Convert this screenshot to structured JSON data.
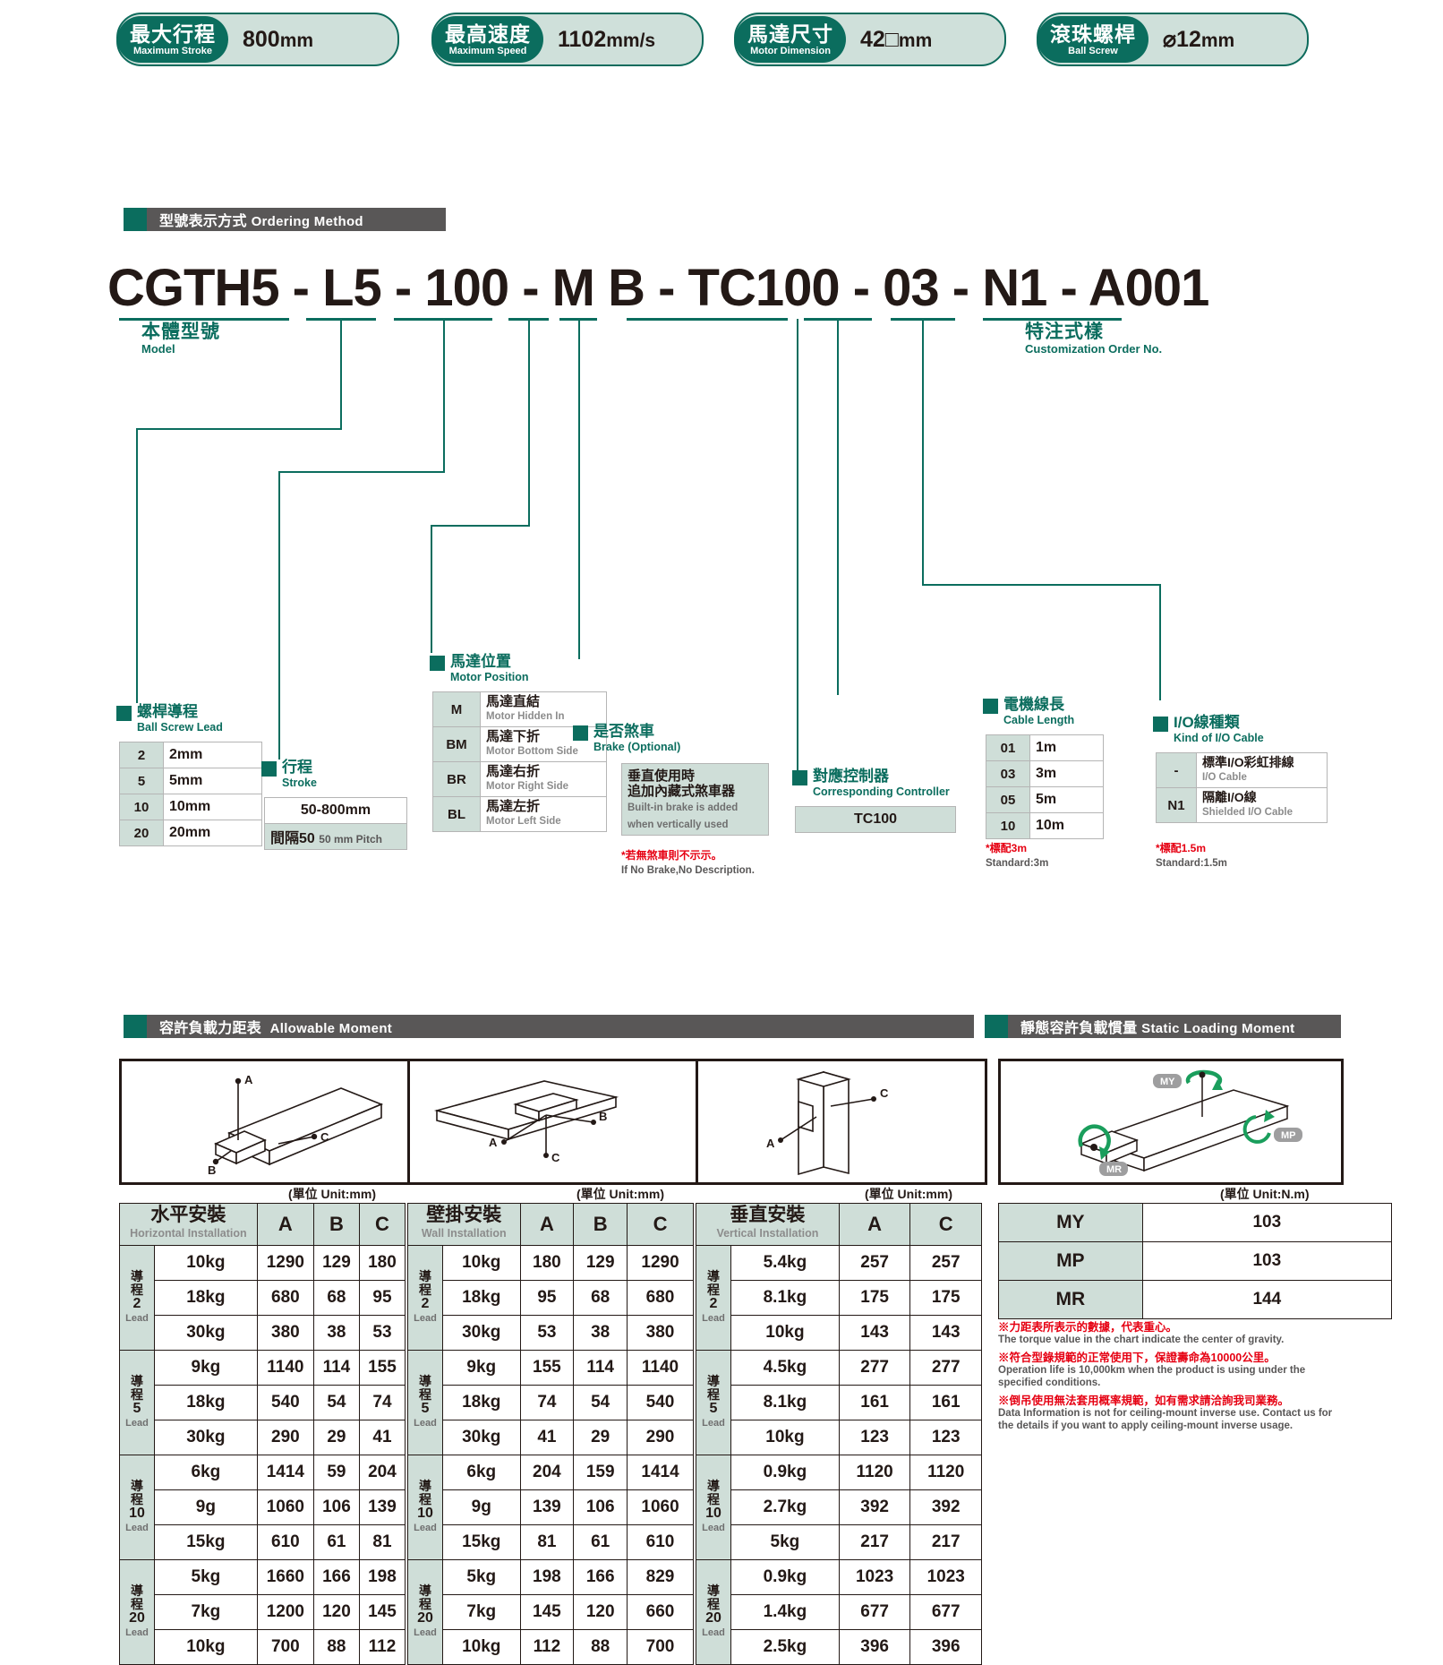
{
  "header_badges": [
    {
      "cn": "最大行程",
      "en": "Maximum Stroke",
      "value": "800",
      "unit": "mm"
    },
    {
      "cn": "最高速度",
      "en": "Maximum Speed",
      "value": "1102",
      "unit": "mm/s"
    },
    {
      "cn": "馬達尺寸",
      "en": "Motor Dimension",
      "value": "42□",
      "unit": "mm"
    },
    {
      "cn": "滾珠螺桿",
      "en": "Ball Screw",
      "value": "⌀12",
      "unit": "mm"
    }
  ],
  "sections": {
    "ordering": {
      "cn": "型號表示方式",
      "en": "Ordering Method"
    },
    "allowable": {
      "cn": "容許負載力距表",
      "en": "Allowable Moment"
    },
    "static": {
      "cn": "靜態容許負載慣量",
      "en": "Static Loading Moment"
    }
  },
  "ordering": {
    "code": "CGTH5 - L5 - 100 - M B - TC100 - 03 - N1 - A001",
    "model_label": {
      "cn": "本體型號",
      "en": "Model"
    },
    "custom_label": {
      "cn": "特注式樣",
      "en": "Customization Order No."
    },
    "ball_screw_lead": {
      "cn": "螺桿導程",
      "en": "Ball Screw Lead",
      "rows": [
        [
          "2",
          "2mm"
        ],
        [
          "5",
          "5mm"
        ],
        [
          "10",
          "10mm"
        ],
        [
          "20",
          "20mm"
        ]
      ]
    },
    "stroke": {
      "cn": "行程",
      "en": "Stroke",
      "value": "50-800mm",
      "pitch_cn": "間隔50",
      "pitch_en": "50 mm Pitch"
    },
    "motor_position": {
      "cn": "馬達位置",
      "en": "Motor Position",
      "rows": [
        [
          "M",
          "馬達直結",
          "Motor Hidden In"
        ],
        [
          "BM",
          "馬達下折",
          "Motor Bottom Side"
        ],
        [
          "BR",
          "馬達右折",
          "Motor Right Side"
        ],
        [
          "BL",
          "馬達左折",
          "Motor Left Side"
        ]
      ]
    },
    "brake": {
      "cn": "是否煞車",
      "en": "Brake (Optional)",
      "desc_cn": "垂直使用時\n追加內藏式煞車器",
      "desc_cn1": "垂直使用時",
      "desc_cn2": "追加內藏式煞車器",
      "desc_en1": "Built-in brake is added",
      "desc_en2": "when vertically used",
      "note_red": "*若無煞車則不示示。",
      "note_gray": "If No Brake,No Description."
    },
    "controller": {
      "cn": "對應控制器",
      "en": "Corresponding Controller",
      "value": "TC100"
    },
    "cable_length": {
      "cn": "電機線長",
      "en": "Cable Length",
      "rows": [
        [
          "01",
          "1m"
        ],
        [
          "03",
          "3m"
        ],
        [
          "05",
          "5m"
        ],
        [
          "10",
          "10m"
        ]
      ],
      "note_red": "*標配3m",
      "note_gray": "Standard:3m"
    },
    "io_cable": {
      "cn": "I/O線種類",
      "en": "Kind of I/O Cable",
      "rows": [
        [
          "-",
          "標準I/O彩虹排線",
          "I/O Cable"
        ],
        [
          "N1",
          "隔離I/O線",
          "Shielded I/O Cable"
        ]
      ],
      "note_red": "*標配1.5m",
      "note_gray": "Standard:1.5m"
    }
  },
  "moment_tables": {
    "unit_label": "(單位 Unit:mm)",
    "horizontal": {
      "cn": "水平安裝",
      "en": "Horizontal Installation",
      "columns": [
        "A",
        "B",
        "C"
      ],
      "groups": [
        {
          "lead": "2",
          "lead_cn": "導程",
          "lead_en": "Lead",
          "rows": [
            {
              "kg": "10kg",
              "vals": [
                "1290",
                "129",
                "180"
              ]
            },
            {
              "kg": "18kg",
              "vals": [
                "680",
                "68",
                "95"
              ]
            },
            {
              "kg": "30kg",
              "vals": [
                "380",
                "38",
                "53"
              ]
            }
          ]
        },
        {
          "lead": "5",
          "lead_cn": "導程",
          "lead_en": "Lead",
          "rows": [
            {
              "kg": "9kg",
              "vals": [
                "1140",
                "114",
                "155"
              ]
            },
            {
              "kg": "18kg",
              "vals": [
                "540",
                "54",
                "74"
              ]
            },
            {
              "kg": "30kg",
              "vals": [
                "290",
                "29",
                "41"
              ]
            }
          ]
        },
        {
          "lead": "10",
          "lead_cn": "導程",
          "lead_en": "Lead",
          "rows": [
            {
              "kg": "6kg",
              "vals": [
                "1414",
                "59",
                "204"
              ]
            },
            {
              "kg": "9g",
              "vals": [
                "1060",
                "106",
                "139"
              ]
            },
            {
              "kg": "15kg",
              "vals": [
                "610",
                "61",
                "81"
              ]
            }
          ]
        },
        {
          "lead": "20",
          "lead_cn": "導程",
          "lead_en": "Lead",
          "rows": [
            {
              "kg": "5kg",
              "vals": [
                "1660",
                "166",
                "198"
              ]
            },
            {
              "kg": "7kg",
              "vals": [
                "1200",
                "120",
                "145"
              ]
            },
            {
              "kg": "10kg",
              "vals": [
                "700",
                "88",
                "112"
              ]
            }
          ]
        }
      ]
    },
    "wall": {
      "cn": "壁掛安裝",
      "en": "Wall Installation",
      "columns": [
        "A",
        "B",
        "C"
      ],
      "groups": [
        {
          "lead": "2",
          "lead_cn": "導程",
          "lead_en": "Lead",
          "rows": [
            {
              "kg": "10kg",
              "vals": [
                "180",
                "129",
                "1290"
              ]
            },
            {
              "kg": "18kg",
              "vals": [
                "95",
                "68",
                "680"
              ]
            },
            {
              "kg": "30kg",
              "vals": [
                "53",
                "38",
                "380"
              ]
            }
          ]
        },
        {
          "lead": "5",
          "lead_cn": "導程",
          "lead_en": "Lead",
          "rows": [
            {
              "kg": "9kg",
              "vals": [
                "155",
                "114",
                "1140"
              ]
            },
            {
              "kg": "18kg",
              "vals": [
                "74",
                "54",
                "540"
              ]
            },
            {
              "kg": "30kg",
              "vals": [
                "41",
                "29",
                "290"
              ]
            }
          ]
        },
        {
          "lead": "10",
          "lead_cn": "導程",
          "lead_en": "Lead",
          "rows": [
            {
              "kg": "6kg",
              "vals": [
                "204",
                "159",
                "1414"
              ]
            },
            {
              "kg": "9g",
              "vals": [
                "139",
                "106",
                "1060"
              ]
            },
            {
              "kg": "15kg",
              "vals": [
                "81",
                "61",
                "610"
              ]
            }
          ]
        },
        {
          "lead": "20",
          "lead_cn": "導程",
          "lead_en": "Lead",
          "rows": [
            {
              "kg": "5kg",
              "vals": [
                "198",
                "166",
                "829"
              ]
            },
            {
              "kg": "7kg",
              "vals": [
                "145",
                "120",
                "660"
              ]
            },
            {
              "kg": "10kg",
              "vals": [
                "112",
                "88",
                "700"
              ]
            }
          ]
        }
      ]
    },
    "vertical": {
      "cn": "垂直安裝",
      "en": "Vertical Installation",
      "columns": [
        "A",
        "C"
      ],
      "groups": [
        {
          "lead": "2",
          "lead_cn": "導程",
          "lead_en": "Lead",
          "rows": [
            {
              "kg": "5.4kg",
              "vals": [
                "257",
                "257"
              ]
            },
            {
              "kg": "8.1kg",
              "vals": [
                "175",
                "175"
              ]
            },
            {
              "kg": "10kg",
              "vals": [
                "143",
                "143"
              ]
            }
          ]
        },
        {
          "lead": "5",
          "lead_cn": "導程",
          "lead_en": "Lead",
          "rows": [
            {
              "kg": "4.5kg",
              "vals": [
                "277",
                "277"
              ]
            },
            {
              "kg": "8.1kg",
              "vals": [
                "161",
                "161"
              ]
            },
            {
              "kg": "10kg",
              "vals": [
                "123",
                "123"
              ]
            }
          ]
        },
        {
          "lead": "10",
          "lead_cn": "導程",
          "lead_en": "Lead",
          "rows": [
            {
              "kg": "0.9kg",
              "vals": [
                "1120",
                "1120"
              ]
            },
            {
              "kg": "2.7kg",
              "vals": [
                "392",
                "392"
              ]
            },
            {
              "kg": "5kg",
              "vals": [
                "217",
                "217"
              ]
            }
          ]
        },
        {
          "lead": "20",
          "lead_cn": "導程",
          "lead_en": "Lead",
          "rows": [
            {
              "kg": "0.9kg",
              "vals": [
                "1023",
                "1023"
              ]
            },
            {
              "kg": "1.4kg",
              "vals": [
                "677",
                "677"
              ]
            },
            {
              "kg": "2.5kg",
              "vals": [
                "396",
                "396"
              ]
            }
          ]
        }
      ]
    }
  },
  "static_loading": {
    "unit_label": "(單位 Unit:N.m)",
    "rows": [
      {
        "name": "MY",
        "value": "103"
      },
      {
        "name": "MP",
        "value": "103"
      },
      {
        "name": "MR",
        "value": "144"
      }
    ],
    "diagram_labels": [
      "MY",
      "MP",
      "MR"
    ],
    "notes": [
      {
        "cn": "※力距表所表示的數據，代表重心。",
        "en": "The torque value in the chart indicate the center of gravity."
      },
      {
        "cn": "※符合型錄規範的正常使用下，保證壽命為10000公里。",
        "en": "Operation life is 10,000km when the product is using under the specified conditions."
      },
      {
        "cn": "※倒吊使用無法套用概率規範，如有需求請洽詢我司業務。",
        "en": "Data Information is not for ceiling-mount inverse use. Contact us for the details if you want to apply ceiling-mount inverse usage."
      }
    ]
  },
  "diagram_axis_labels": {
    "horizontal": [
      "A",
      "B",
      "C"
    ],
    "wall": [
      "A",
      "B",
      "C"
    ],
    "vertical": [
      "A",
      "C"
    ]
  },
  "colors": {
    "brand_green": "#0b6d5e",
    "bar_gray": "#595757",
    "table_head": "#cfded8",
    "red": "#e60012"
  }
}
